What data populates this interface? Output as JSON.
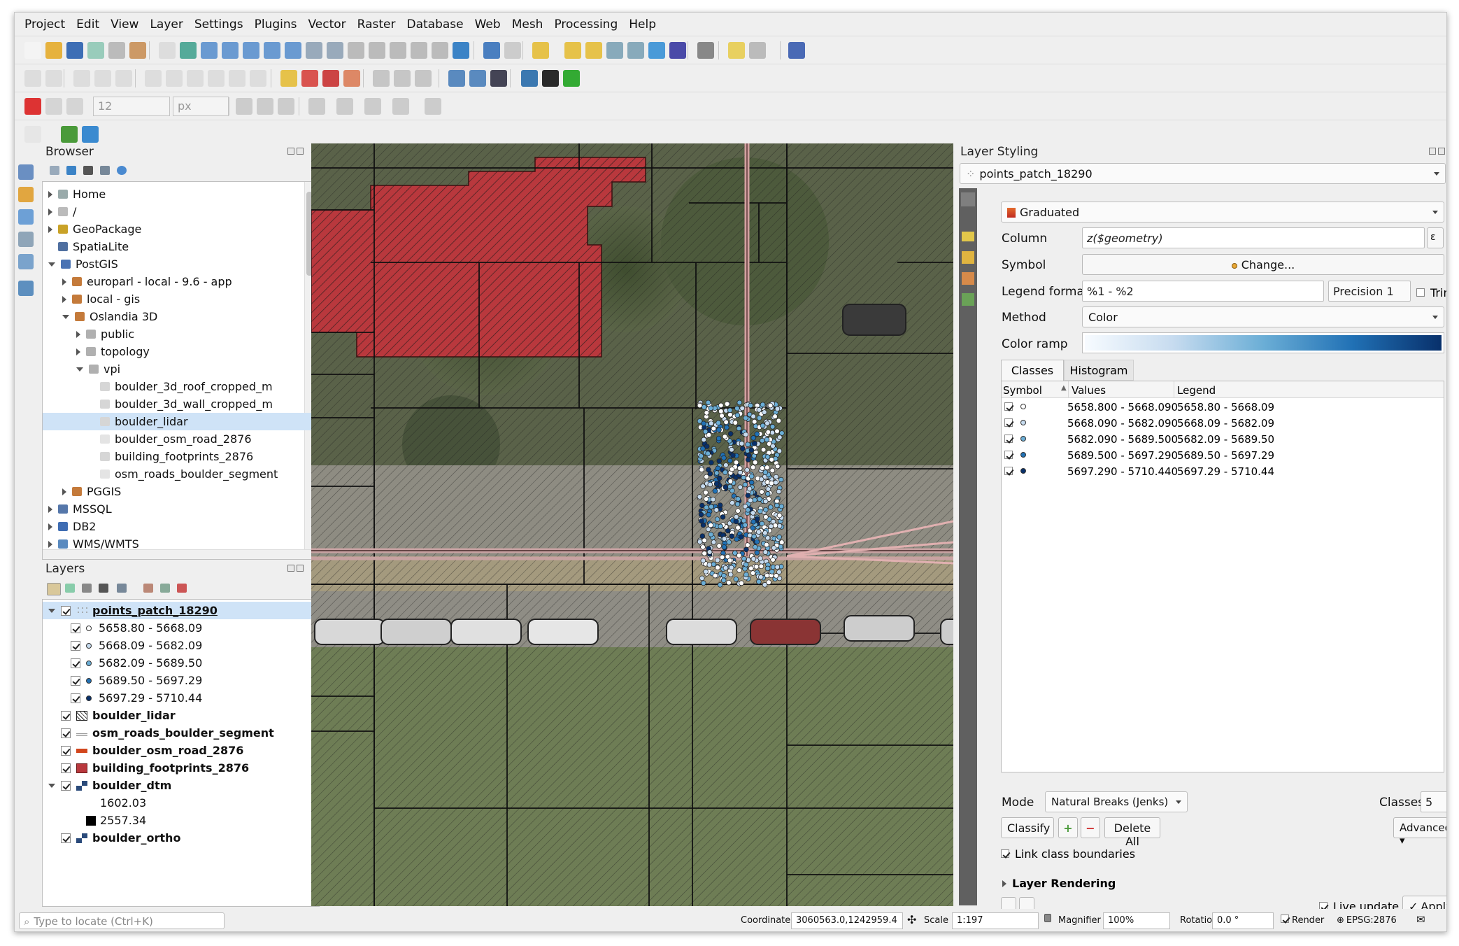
{
  "menu": [
    "Project",
    "Edit",
    "View",
    "Layer",
    "Settings",
    "Plugins",
    "Vector",
    "Raster",
    "Database",
    "Web",
    "Mesh",
    "Processing",
    "Help"
  ],
  "toolbar": {
    "snap_tolerance": "12",
    "snap_unit": "px"
  },
  "browser": {
    "title": "Browser",
    "items": [
      {
        "label": "Home",
        "icon": "home-icon",
        "level": 0,
        "expanded": false
      },
      {
        "label": "/",
        "icon": "folder-icon",
        "level": 0,
        "expanded": false
      },
      {
        "label": "GeoPackage",
        "icon": "geopackage-icon",
        "level": 0,
        "expanded": false
      },
      {
        "label": "SpatiaLite",
        "icon": "spatialite-icon",
        "level": 0,
        "expanded": null
      },
      {
        "label": "PostGIS",
        "icon": "postgis-icon",
        "level": 0,
        "expanded": true
      },
      {
        "label": "europarl - local - 9.6 - app",
        "icon": "connection-icon",
        "level": 1,
        "expanded": false
      },
      {
        "label": "local - gis",
        "icon": "connection-icon",
        "level": 1,
        "expanded": false
      },
      {
        "label": "Oslandia 3D",
        "icon": "connection-icon",
        "level": 1,
        "expanded": true
      },
      {
        "label": "public",
        "icon": "schema-icon",
        "level": 2,
        "expanded": false
      },
      {
        "label": "topology",
        "icon": "schema-icon",
        "level": 2,
        "expanded": false
      },
      {
        "label": "vpi",
        "icon": "schema-icon",
        "level": 2,
        "expanded": true
      },
      {
        "label": "boulder_3d_roof_cropped_m",
        "icon": "polygon-table-icon",
        "level": 3,
        "expanded": null
      },
      {
        "label": "boulder_3d_wall_cropped_m",
        "icon": "polygon-table-icon",
        "level": 3,
        "expanded": null
      },
      {
        "label": "boulder_lidar",
        "icon": "polygon-table-icon",
        "level": 3,
        "expanded": null,
        "selected": true
      },
      {
        "label": "boulder_osm_road_2876",
        "icon": "line-table-icon",
        "level": 3,
        "expanded": null
      },
      {
        "label": "building_footprints_2876",
        "icon": "polygon-table-icon",
        "level": 3,
        "expanded": null
      },
      {
        "label": "osm_roads_boulder_segment",
        "icon": "line-table-icon",
        "level": 3,
        "expanded": null
      },
      {
        "label": "PGGIS",
        "icon": "connection-icon",
        "level": 1,
        "expanded": false
      },
      {
        "label": "MSSQL",
        "icon": "mssql-icon",
        "level": 0,
        "expanded": false
      },
      {
        "label": "DB2",
        "icon": "db2-icon",
        "level": 0,
        "expanded": false
      },
      {
        "label": "WMS/WMTS",
        "icon": "wms-icon",
        "level": 0,
        "expanded": false
      }
    ]
  },
  "layers": {
    "title": "Layers",
    "items": [
      {
        "label": "points_patch_18290",
        "level": 0,
        "bold": true,
        "underline": true,
        "selected": true,
        "expand": "down",
        "sym": "points-icon"
      },
      {
        "label": "5658.80 - 5668.09",
        "level": 1,
        "dot": "#ffffff"
      },
      {
        "label": "5668.09 - 5682.09",
        "level": 1,
        "dot": "#c6dbef"
      },
      {
        "label": "5682.09 - 5689.50",
        "level": 1,
        "dot": "#6baed6"
      },
      {
        "label": "5689.50 - 5697.29",
        "level": 1,
        "dot": "#2171b5"
      },
      {
        "label": "5697.29 - 5710.44",
        "level": 1,
        "dot": "#08306b"
      },
      {
        "label": "boulder_lidar",
        "level": 0,
        "bold": true,
        "sym": "hatch-icon"
      },
      {
        "label": "osm_roads_boulder_segment",
        "level": 0,
        "bold": true,
        "sym": "line-icon"
      },
      {
        "label": "boulder_osm_road_2876",
        "level": 0,
        "bold": true,
        "sym": "road-icon"
      },
      {
        "label": "building_footprints_2876",
        "level": 0,
        "bold": true,
        "sym": "fill-icon"
      },
      {
        "label": "boulder_dtm",
        "level": 0,
        "bold": true,
        "expand": "down",
        "sym": "raster-icon"
      },
      {
        "label": "1602.03",
        "level": 1,
        "swatch": "#ffffff",
        "nocb": true
      },
      {
        "label": "2557.34",
        "level": 1,
        "swatch": "#000000",
        "nocb": true
      },
      {
        "label": "boulder_ortho",
        "level": 0,
        "bold": true,
        "sym": "raster-icon"
      }
    ]
  },
  "styling": {
    "title": "Layer Styling",
    "layer": "points_patch_18290",
    "renderer": "Graduated",
    "column_label": "Column",
    "column": "z($geometry)",
    "symbol_label": "Symbol",
    "symbol_btn": "Change...",
    "legend_label": "Legend format",
    "legend_format": "%1 - %2",
    "precision": "Precision 1",
    "trim": "Trim",
    "method_label": "Method",
    "method": "Color",
    "ramp_label": "Color ramp",
    "tabs": [
      "Classes",
      "Histogram"
    ],
    "headers": [
      "Symbol",
      "Values",
      "Legend"
    ],
    "classes": [
      {
        "values": "5658.800 - 5668.090",
        "legend": "5658.80 - 5668.09",
        "color": "#ffffff"
      },
      {
        "values": "5668.090 - 5682.090",
        "legend": "5668.09 - 5682.09",
        "color": "#c6dbef"
      },
      {
        "values": "5682.090 - 5689.500",
        "legend": "5682.09 - 5689.50",
        "color": "#6baed6"
      },
      {
        "values": "5689.500 - 5697.290",
        "legend": "5689.50 - 5697.29",
        "color": "#2171b5"
      },
      {
        "values": "5697.290 - 5710.440",
        "legend": "5697.29 - 5710.44",
        "color": "#08306b"
      }
    ],
    "mode_label": "Mode",
    "mode": "Natural Breaks (Jenks)",
    "classes_label": "Classes",
    "classes_count": "5",
    "classify": "Classify",
    "delete_all": "Delete All",
    "advanced": "Advanced",
    "link": "Link class boundaries",
    "rendering": "Layer Rendering",
    "live": "Live update",
    "apply": "Apply"
  },
  "status": {
    "locate": "Type to locate (Ctrl+K)",
    "coord_label": "Coordinate",
    "coord": "3060563.0,1242959.4",
    "scale_label": "Scale",
    "scale": "1:197",
    "mag_label": "Magnifier",
    "mag": "100%",
    "rot_label": "Rotation",
    "rot": "0.0 °",
    "render": "Render",
    "crs": "EPSG:2876"
  },
  "colors": {
    "building": "#b9383d",
    "accent": "#cfe3f7",
    "ramp_start": "#f7fbff",
    "ramp_end": "#08306b"
  }
}
